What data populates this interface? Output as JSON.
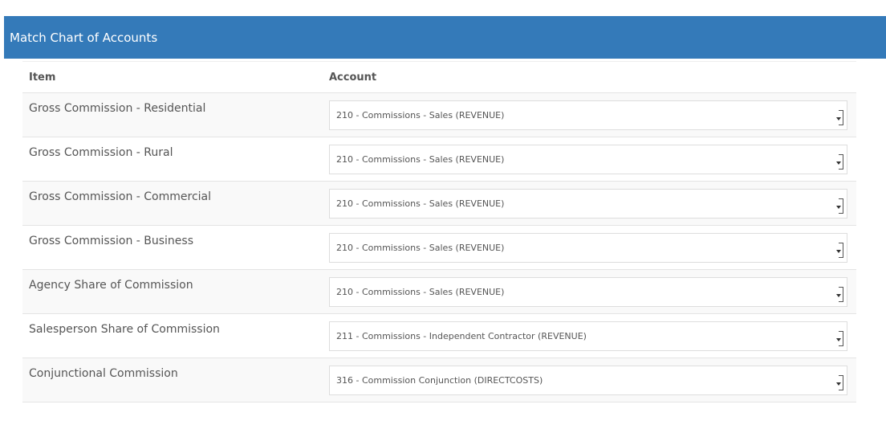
{
  "panel": {
    "title": "Match Chart of Accounts"
  },
  "table": {
    "headers": {
      "item": "Item",
      "account": "Account"
    },
    "rows": [
      {
        "item": "Gross Commission - Residential",
        "account": "210 - Commissions - Sales (REVENUE)"
      },
      {
        "item": "Gross Commission - Rural",
        "account": "210 - Commissions - Sales (REVENUE)"
      },
      {
        "item": "Gross Commission - Commercial",
        "account": "210 - Commissions - Sales (REVENUE)"
      },
      {
        "item": "Gross Commission - Business",
        "account": "210 - Commissions - Sales (REVENUE)"
      },
      {
        "item": "Agency Share of Commission",
        "account": "210 - Commissions - Sales (REVENUE)"
      },
      {
        "item": "Salesperson Share of Commission",
        "account": "211 - Commissions - Independent Contractor (REVENUE)"
      },
      {
        "item": "Conjunctional Commission",
        "account": "316 - Commission Conjunction (DIRECTCOSTS)"
      }
    ]
  },
  "colors": {
    "header_bg": "#347ab9",
    "row_alt_bg": "#f9f9f9"
  },
  "icons": {
    "select_arrow": "dropdown-arrow-icon"
  }
}
